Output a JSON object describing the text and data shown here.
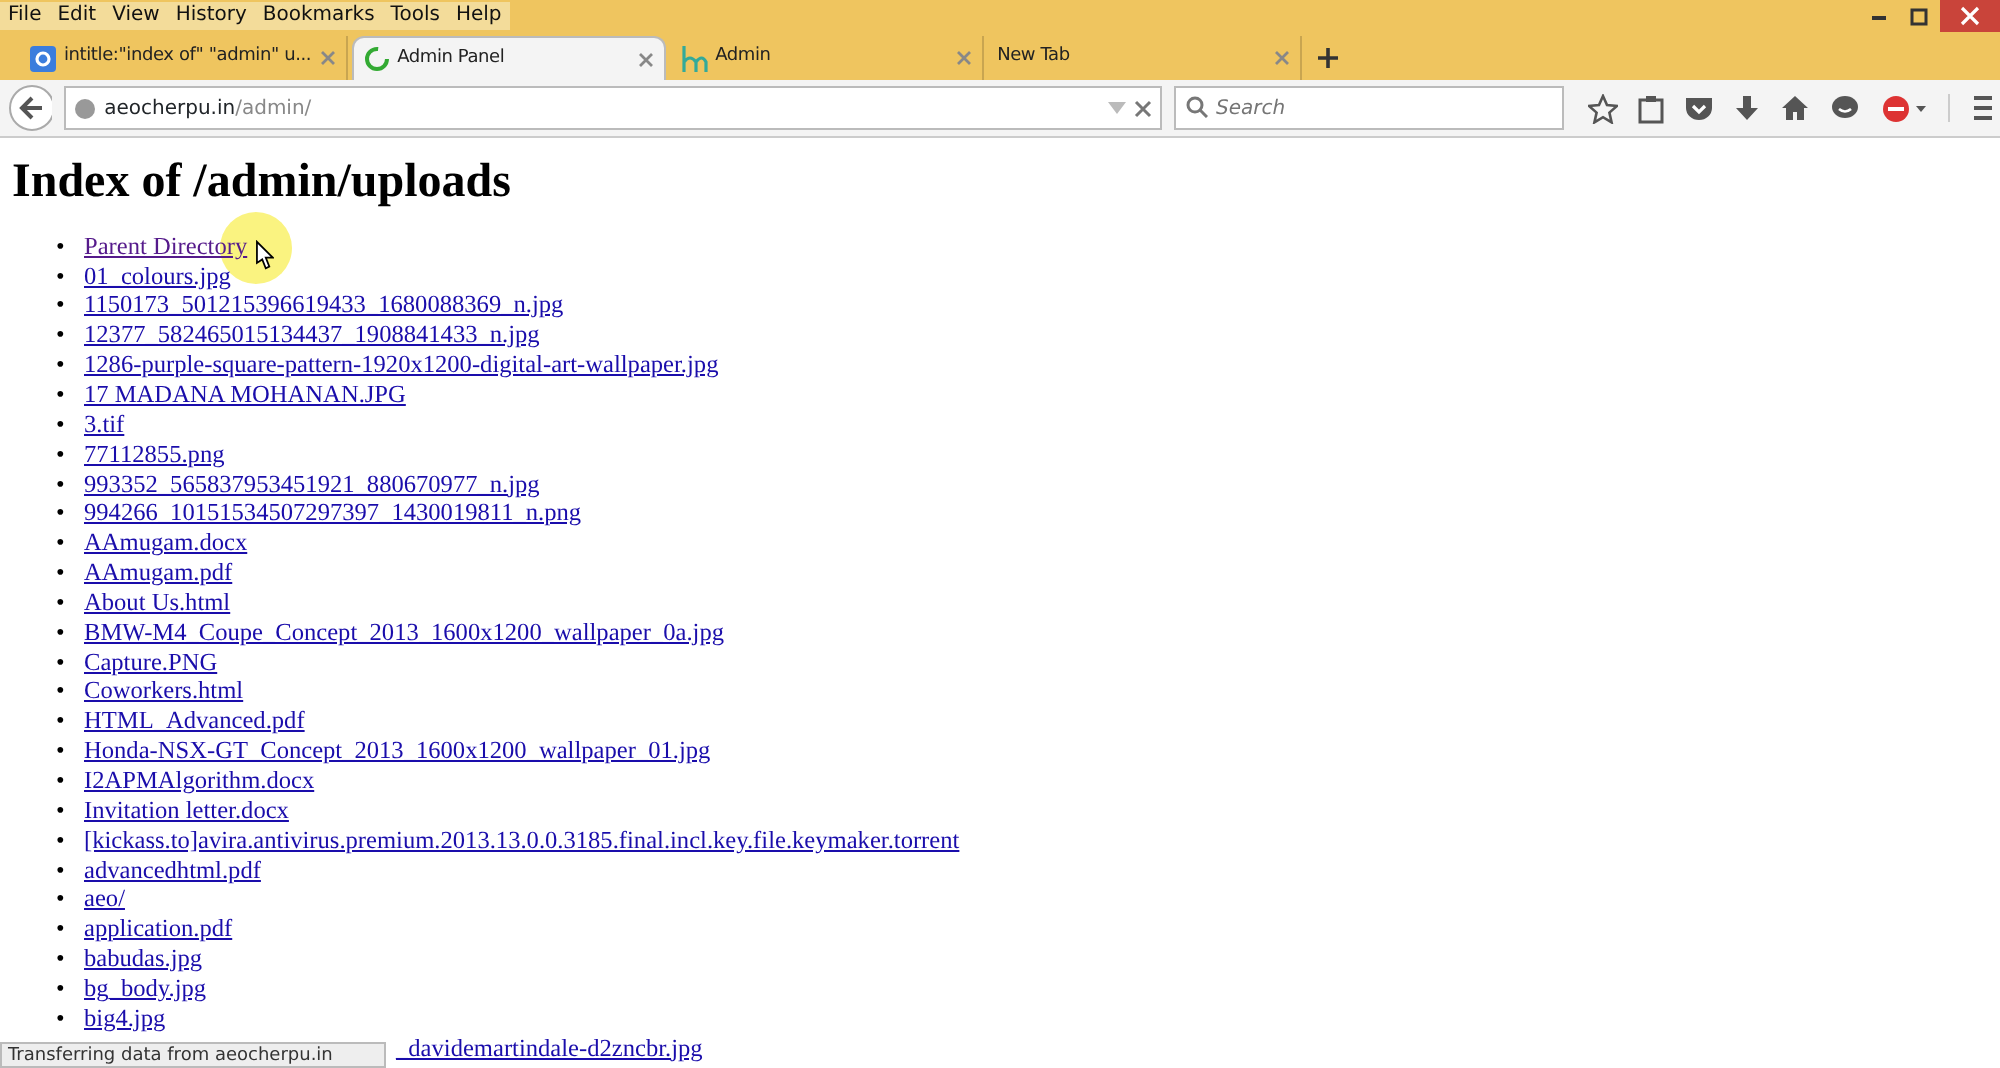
{
  "menu": [
    "File",
    "Edit",
    "View",
    "History",
    "Bookmarks",
    "Tools",
    "Help"
  ],
  "tabs": [
    {
      "label": "intitle:\"index of\" \"admin\" u...",
      "selected": false,
      "kind": "google"
    },
    {
      "label": "Admin Panel",
      "selected": true,
      "kind": "loading"
    },
    {
      "label": "Admin",
      "selected": false,
      "kind": "h"
    },
    {
      "label": "New Tab",
      "selected": false,
      "kind": "none"
    }
  ],
  "address": {
    "host": "aeocherpu.in",
    "path": "/admin/"
  },
  "search": {
    "placeholder": "Search"
  },
  "page": {
    "heading": "Index of /admin/uploads",
    "items": [
      {
        "text": "Parent Directory",
        "kind": "link",
        "marker": "•"
      },
      {
        "text": "01_colours.jpg",
        "kind": "link",
        "marker": "•"
      },
      {
        "text": "1150173_501215396619433_1680088369_n.jpg",
        "kind": "link",
        "marker": "•"
      },
      {
        "text": "12377_582465015134437_1908841433_n.jpg",
        "kind": "link",
        "marker": "•"
      },
      {
        "text": "1286-purple-square-pattern-1920x1200-digital-art-wallpaper.jpg",
        "kind": "link",
        "marker": "•"
      },
      {
        "text": "17 MADANA MOHANAN.JPG",
        "kind": "link",
        "marker": "•"
      },
      {
        "text": "3.tif",
        "kind": "link",
        "marker": "•"
      },
      {
        "text": "77112855.png",
        "kind": "link",
        "marker": "•"
      },
      {
        "text": "993352_565837953451921_880670977_n.jpg",
        "kind": "link",
        "marker": "•"
      },
      {
        "text": "994266_10151534507297397_1430019811_n.png",
        "kind": "link",
        "marker": "•"
      },
      {
        "text": "AAmugam.docx",
        "kind": "link",
        "marker": "•"
      },
      {
        "text": "AAmugam.pdf",
        "kind": "link",
        "marker": "•"
      },
      {
        "text": "About Us.html",
        "kind": "link",
        "marker": "•"
      },
      {
        "text": "BMW-M4_Coupe_Concept_2013_1600x1200_wallpaper_0a.jpg",
        "kind": "link",
        "marker": "•"
      },
      {
        "text": "Capture.PNG",
        "kind": "link",
        "marker": "•"
      },
      {
        "text": "Coworkers.html",
        "kind": "link",
        "marker": "•"
      },
      {
        "text": "HTML_Advanced.pdf",
        "kind": "link",
        "marker": "•"
      },
      {
        "text": "Honda-NSX-GT_Concept_2013_1600x1200_wallpaper_01.jpg",
        "kind": "link",
        "marker": "•"
      },
      {
        "text": "I2APMAlgorithm.docx",
        "kind": "link",
        "marker": "•"
      },
      {
        "text": "Invitation letter.docx",
        "kind": "link",
        "marker": "•"
      },
      {
        "text": "[kickass.to]avira.antivirus.premium.2013.13.0.0.3185.final.incl.key.file.keymaker.torrent",
        "kind": "link",
        "marker": "•"
      },
      {
        "text": "advancedhtml.pdf",
        "kind": "link",
        "marker": "•"
      },
      {
        "text": "aeo/",
        "kind": "link",
        "marker": "•"
      },
      {
        "text": "application.pdf",
        "kind": "link",
        "marker": "•"
      },
      {
        "text": "babudas.jpg",
        "kind": "link",
        "marker": "•"
      },
      {
        "text": "bg_body.jpg",
        "kind": "link",
        "marker": "•"
      },
      {
        "text": "big4.jpg",
        "kind": "link",
        "marker": "•"
      },
      {
        "text": "_davidemartindale-d2zncbr.jpg",
        "kind": "partial"
      }
    ]
  },
  "status_bar": "Transferring data from aeocherpu.in"
}
